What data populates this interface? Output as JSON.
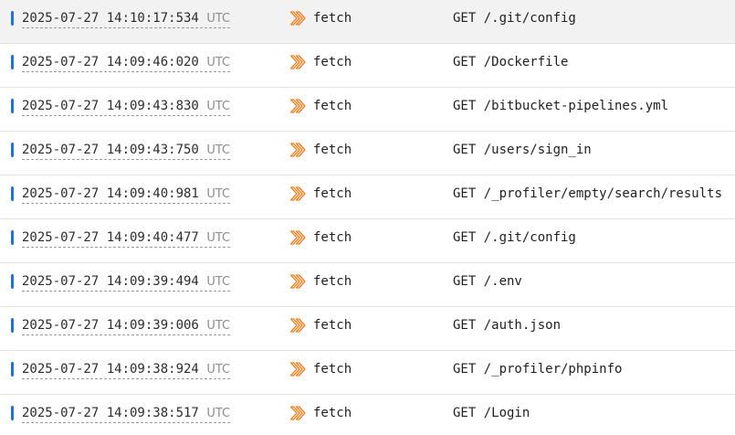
{
  "colors": {
    "indicator": "#1a73e8",
    "fetch_icon": "#f38020",
    "highlight_row": "#f2f2f2"
  },
  "icons": {
    "source": "chevrons-right-outline-icon"
  },
  "rows": [
    {
      "timestamp": "2025-07-27 14:10:17:534",
      "zone": "UTC",
      "source": "fetch",
      "message": "GET /.git/config",
      "highlighted": true
    },
    {
      "timestamp": "2025-07-27 14:09:46:020",
      "zone": "UTC",
      "source": "fetch",
      "message": "GET /Dockerfile",
      "highlighted": false
    },
    {
      "timestamp": "2025-07-27 14:09:43:830",
      "zone": "UTC",
      "source": "fetch",
      "message": "GET /bitbucket-pipelines.yml",
      "highlighted": false
    },
    {
      "timestamp": "2025-07-27 14:09:43:750",
      "zone": "UTC",
      "source": "fetch",
      "message": "GET /users/sign_in",
      "highlighted": false
    },
    {
      "timestamp": "2025-07-27 14:09:40:981",
      "zone": "UTC",
      "source": "fetch",
      "message": "GET /_profiler/empty/search/results",
      "highlighted": false
    },
    {
      "timestamp": "2025-07-27 14:09:40:477",
      "zone": "UTC",
      "source": "fetch",
      "message": "GET /.git/config",
      "highlighted": false
    },
    {
      "timestamp": "2025-07-27 14:09:39:494",
      "zone": "UTC",
      "source": "fetch",
      "message": "GET /.env",
      "highlighted": false
    },
    {
      "timestamp": "2025-07-27 14:09:39:006",
      "zone": "UTC",
      "source": "fetch",
      "message": "GET /auth.json",
      "highlighted": false
    },
    {
      "timestamp": "2025-07-27 14:09:38:924",
      "zone": "UTC",
      "source": "fetch",
      "message": "GET /_profiler/phpinfo",
      "highlighted": false
    },
    {
      "timestamp": "2025-07-27 14:09:38:517",
      "zone": "UTC",
      "source": "fetch",
      "message": "GET /Login",
      "highlighted": false
    }
  ]
}
